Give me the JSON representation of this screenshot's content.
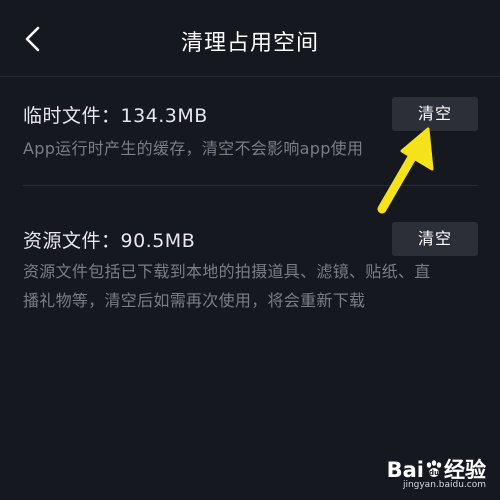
{
  "header": {
    "title": "清理占用空间",
    "back_icon": "chevron-left-icon"
  },
  "items": [
    {
      "title": "临时文件：134.3MB",
      "description": "App运行时产生的缓存，清空不会影响app使用",
      "button_label": "清空"
    },
    {
      "title": "资源文件：90.5MB",
      "description_line1": "资源文件包括已下载到本地的拍摄道具、滤镜、贴纸、直",
      "description_line2": "播礼物等，清空后如需再次使用，将会重新下载",
      "button_label": "清空"
    }
  ],
  "annotation": {
    "arrow_color": "#f5e21b",
    "arrow_icon": "arrow-up-right-icon"
  },
  "watermark": {
    "logo_text_left": "Bai",
    "logo_text_right": "经验",
    "url": "jingyan.baidu.com"
  },
  "colors": {
    "background": "#16181f",
    "button_bg": "#2d2f38",
    "desc_text": "#7a7d88"
  }
}
